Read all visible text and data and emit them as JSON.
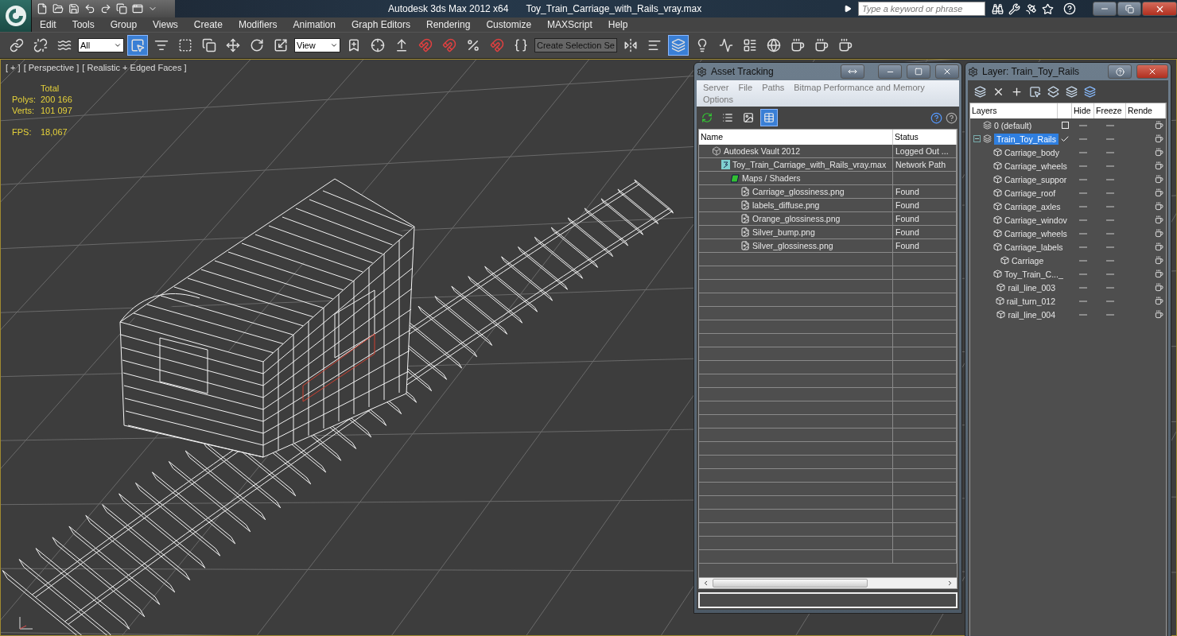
{
  "title_bar": {
    "app_title": "Autodesk 3ds Max  2012 x64",
    "file_title": "Toy_Train_Carriage_with_Rails_vray.max",
    "search": {
      "placeholder": "Type a keyword or phrase"
    }
  },
  "menu": [
    "Edit",
    "Tools",
    "Group",
    "Views",
    "Create",
    "Modifiers",
    "Animation",
    "Graph Editors",
    "Rendering",
    "Customize",
    "MAXScript",
    "Help"
  ],
  "toolbar": {
    "selection_filter": "All",
    "reference_coordinates": "View",
    "named_selection": "Create Selection Se",
    "items": [
      {
        "kind": "link",
        "selected": false
      },
      {
        "kind": "unlink",
        "selected": false
      },
      {
        "kind": "bind",
        "selected": false
      },
      {
        "kind": "filter",
        "selected": false
      },
      {
        "kind": "select",
        "selected": true
      },
      {
        "kind": "select-by-name",
        "selected": false
      },
      {
        "kind": "region",
        "selected": false
      },
      {
        "kind": "crossing",
        "selected": false
      },
      {
        "kind": "move",
        "selected": false
      },
      {
        "kind": "rotate",
        "selected": false
      },
      {
        "kind": "scale",
        "selected": false
      },
      {
        "kind": "coords",
        "selected": false
      },
      {
        "kind": "pivot",
        "selected": false
      },
      {
        "kind": "manipulate",
        "selected": false
      },
      {
        "kind": "keyboard",
        "selected": false
      },
      {
        "kind": "snap",
        "selected": false
      },
      {
        "kind": "angle-snap",
        "selected": false
      },
      {
        "kind": "percent-snap",
        "selected": false
      },
      {
        "kind": "spinner-snap",
        "selected": false
      },
      {
        "kind": "edit-named",
        "selected": false
      },
      {
        "kind": "named",
        "selected": false
      },
      {
        "kind": "mirror",
        "selected": false
      },
      {
        "kind": "align",
        "selected": false
      },
      {
        "kind": "layers",
        "selected": true
      },
      {
        "kind": "scene-explorer",
        "selected": false
      },
      {
        "kind": "curve-editor",
        "selected": false
      },
      {
        "kind": "schematic",
        "selected": false
      },
      {
        "kind": "material",
        "selected": false
      },
      {
        "kind": "render-setup",
        "selected": false
      },
      {
        "kind": "render-frame",
        "selected": false
      },
      {
        "kind": "render",
        "selected": false
      }
    ]
  },
  "viewport": {
    "labels": [
      "[ + ]",
      "[ Perspective ]",
      "[ Realistic + Edged Faces ]"
    ],
    "stats_header": "Total",
    "stats": [
      {
        "label": "Polys:",
        "value": "200 166"
      },
      {
        "label": "Verts:",
        "value": "101 097"
      },
      {
        "label": "FPS:",
        "value": "18,067"
      }
    ]
  },
  "asset_tracking": {
    "title": "Asset Tracking",
    "menu": [
      "Server",
      "File",
      "Paths",
      "Bitmap Performance and Memory",
      "Options"
    ],
    "views": [
      {
        "kind": "refresh",
        "selected": false
      },
      {
        "kind": "list",
        "selected": false
      },
      {
        "kind": "thumbnails",
        "selected": false
      },
      {
        "kind": "table",
        "selected": true
      }
    ],
    "columns": [
      "Name",
      "Status"
    ],
    "rows": [
      {
        "kind": "vault",
        "name": "Autodesk Vault 2012",
        "status": "Logged Out ...",
        "children": [
          {
            "kind": "scene",
            "name": "Toy_Train_Carriage_with_Rails_vray.max",
            "status": "Network Path",
            "children": [
              {
                "kind": "folder",
                "name": "Maps / Shaders",
                "children": [
                  {
                    "kind": "image",
                    "name": "Carriage_glossiness.png",
                    "status": "Found"
                  },
                  {
                    "kind": "image",
                    "name": "labels_diffuse.png",
                    "status": "Found"
                  },
                  {
                    "kind": "image",
                    "name": "Orange_glossiness.png",
                    "status": "Found"
                  },
                  {
                    "kind": "image",
                    "name": "Silver_bump.png",
                    "status": "Found"
                  },
                  {
                    "kind": "image",
                    "name": "Silver_glossiness.png",
                    "status": "Found"
                  }
                ]
              }
            ]
          }
        ]
      }
    ]
  },
  "layer_window": {
    "title": "Layer: Train_Toy_Rails",
    "columns": [
      "Layers",
      "Hide",
      "Freeze",
      "Rende"
    ],
    "layers": [
      {
        "kind": "layer",
        "name": "0 (default)",
        "selected": false,
        "current": false,
        "hidden": false,
        "frozen": false,
        "renderable": true
      },
      {
        "kind": "layer",
        "name": "Train_Toy_Rails",
        "selected": true,
        "current": true,
        "expanded": true,
        "hidden": false,
        "frozen": false,
        "renderable": true,
        "children": [
          {
            "kind": "object",
            "name": "Carriage_body",
            "selected": false,
            "hidden": false,
            "frozen": false,
            "renderable": true
          },
          {
            "kind": "object",
            "name": "Carriage_wheels",
            "selected": false,
            "hidden": false,
            "frozen": false,
            "renderable": true
          },
          {
            "kind": "object",
            "name": "Carriage_suppor",
            "selected": false,
            "hidden": false,
            "frozen": false,
            "renderable": true
          },
          {
            "kind": "object",
            "name": "Carriage_roof",
            "selected": false,
            "hidden": false,
            "frozen": false,
            "renderable": true
          },
          {
            "kind": "object",
            "name": "Carriage_axles",
            "selected": false,
            "hidden": false,
            "frozen": false,
            "renderable": true
          },
          {
            "kind": "object",
            "name": "Carriage_windov",
            "selected": false,
            "hidden": false,
            "frozen": false,
            "renderable": true
          },
          {
            "kind": "object",
            "name": "Carriage_wheels",
            "selected": false,
            "hidden": false,
            "frozen": false,
            "renderable": true
          },
          {
            "kind": "object",
            "name": "Carriage_labels",
            "selected": false,
            "hidden": false,
            "frozen": false,
            "renderable": true
          },
          {
            "kind": "object",
            "name": "Carriage",
            "selected": false,
            "hidden": false,
            "frozen": false,
            "renderable": true
          },
          {
            "kind": "object",
            "name": "Toy_Train_C..._",
            "selected": false,
            "hidden": false,
            "frozen": false,
            "renderable": true
          },
          {
            "kind": "object",
            "name": "rail_line_003",
            "selected": false,
            "hidden": false,
            "frozen": false,
            "renderable": true
          },
          {
            "kind": "object",
            "name": "rail_turn_012",
            "selected": false,
            "hidden": false,
            "frozen": false,
            "renderable": true
          },
          {
            "kind": "object",
            "name": "rail_line_004",
            "selected": false,
            "hidden": false,
            "frozen": false,
            "renderable": true
          }
        ]
      }
    ]
  }
}
